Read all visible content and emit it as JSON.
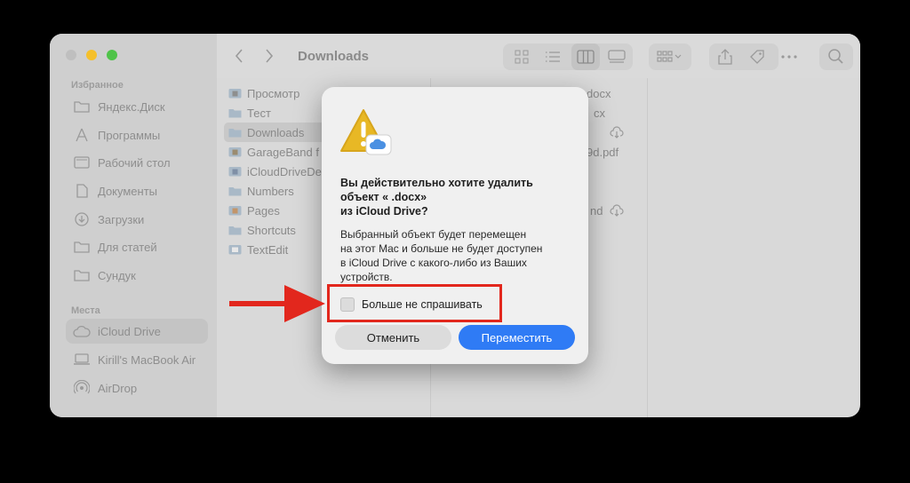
{
  "window": {
    "title": "Downloads"
  },
  "sidebar": {
    "favorites_header": "Избранное",
    "favorites": [
      {
        "label": "Яндекс.Диск",
        "icon": "folder-icon"
      },
      {
        "label": "Программы",
        "icon": "applications-icon"
      },
      {
        "label": "Рабочий стол",
        "icon": "desktop-icon"
      },
      {
        "label": "Документы",
        "icon": "document-icon"
      },
      {
        "label": "Загрузки",
        "icon": "download-icon"
      },
      {
        "label": "Для статей",
        "icon": "folder-icon"
      },
      {
        "label": "Сундук",
        "icon": "folder-icon"
      }
    ],
    "places_header": "Места",
    "places": [
      {
        "label": "iCloud Drive",
        "icon": "icloud-icon"
      },
      {
        "label": "Kirill's MacBook Air",
        "icon": "laptop-icon"
      },
      {
        "label": "AirDrop",
        "icon": "airdrop-icon"
      }
    ]
  },
  "files": [
    {
      "name": "Просмотр",
      "icon": "app-folder-icon"
    },
    {
      "name": "Тест",
      "icon": "folder-icon"
    },
    {
      "name": "Downloads",
      "icon": "folder-icon",
      "selected": true
    },
    {
      "name": "GarageBand f",
      "icon": "app-folder-icon"
    },
    {
      "name": "iCloudDriveDe",
      "icon": "app-folder-icon"
    },
    {
      "name": "Numbers",
      "icon": "app-folder-icon"
    },
    {
      "name": "Pages",
      "icon": "app-folder-icon"
    },
    {
      "name": "Shortcuts",
      "icon": "app-folder-icon"
    },
    {
      "name": "TextEdit",
      "icon": "app-folder-icon"
    }
  ],
  "col2_fragments": {
    "r1": "docx",
    "r2": "cx",
    "r3": "9d.pdf",
    "r4": "nd"
  },
  "dialog": {
    "title_lines": [
      "Вы действительно хотите удалить",
      "объект «                          .docx»",
      "из iCloud Drive?"
    ],
    "message_lines": [
      "Выбранный объект будет перемещен",
      "на этот Mac и больше не будет доступен",
      "в iCloud Drive с какого-либо из Ваших",
      "устройств."
    ],
    "checkbox_label": "Больше не спрашивать",
    "checkbox_checked": false,
    "cancel_label": "Отменить",
    "confirm_label": "Переместить"
  },
  "colors": {
    "accent": "#2f7bf5",
    "annotation": "#e2271d"
  }
}
